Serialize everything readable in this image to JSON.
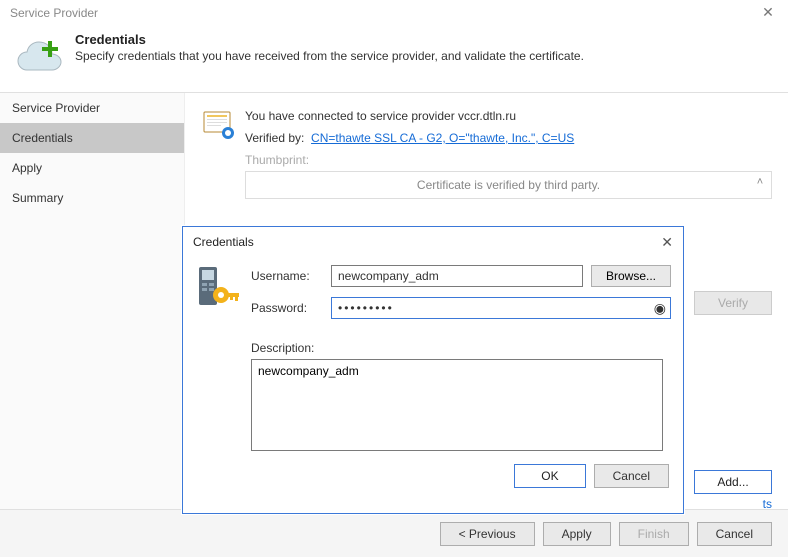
{
  "window_title": "Service Provider",
  "header": {
    "title": "Credentials",
    "description": "Specify credentials that you have received from the service provider, and validate the certificate."
  },
  "sidebar": {
    "items": [
      {
        "label": "Service Provider",
        "active": false
      },
      {
        "label": "Credentials",
        "active": true
      },
      {
        "label": "Apply",
        "active": false
      },
      {
        "label": "Summary",
        "active": false
      }
    ]
  },
  "main": {
    "connected_text": "You have connected to service provider vccr.dtln.ru",
    "verified_by_label": "Verified by:",
    "verified_link": "CN=thawte SSL CA - G2, O=\"thawte, Inc.\", C=US",
    "thumbprint_label": "Thumbprint:",
    "thumbprint_msg": "Certificate is verified by third party.",
    "verify_btn": "Verify",
    "add_btn": "Add...",
    "link_fragment": "ts"
  },
  "footer": {
    "previous": "< Previous",
    "apply": "Apply",
    "finish": "Finish",
    "cancel": "Cancel"
  },
  "dialog": {
    "title": "Credentials",
    "username_label": "Username:",
    "username_value": "newcompany_adm",
    "browse": "Browse...",
    "password_label": "Password:",
    "password_value": "•••••••••",
    "description_label": "Description:",
    "description_value": "newcompany_adm",
    "ok": "OK",
    "cancel": "Cancel"
  }
}
